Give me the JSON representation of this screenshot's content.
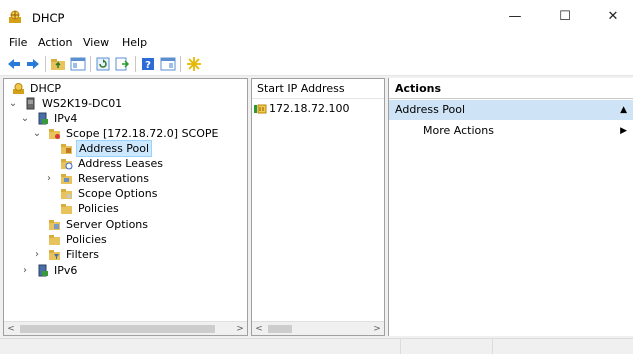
{
  "window": {
    "title": "DHCP",
    "minimize": "—",
    "maximize": "☐",
    "close": "✕"
  },
  "menu": [
    "File",
    "Action",
    "View",
    "Help"
  ],
  "toolbar": [
    "back-icon",
    "forward-icon",
    "up-folder-icon",
    "show-hide-tree-icon",
    "refresh-icon",
    "export-list-icon",
    "help-icon",
    "show-hide-action-pane-icon",
    "new-star-icon"
  ],
  "tree": {
    "nodes": [
      {
        "label": "DHCP"
      },
      {
        "label": "WS2K19-DC01"
      },
      {
        "label": "IPv4"
      },
      {
        "label": "Scope [172.18.72.0] SCOPE"
      },
      {
        "label": "Address Pool"
      },
      {
        "label": "Address Leases"
      },
      {
        "label": "Reservations"
      },
      {
        "label": "Scope Options"
      },
      {
        "label": "Policies"
      },
      {
        "label": "Server Options"
      },
      {
        "label": "Policies"
      },
      {
        "label": "Filters"
      },
      {
        "label": "IPv6"
      }
    ]
  },
  "list": {
    "column_header": "Start IP Address",
    "rows": [
      "172.18.72.100"
    ]
  },
  "actions": {
    "header": "Actions",
    "section": "Address Pool",
    "items": [
      "More Actions"
    ]
  }
}
